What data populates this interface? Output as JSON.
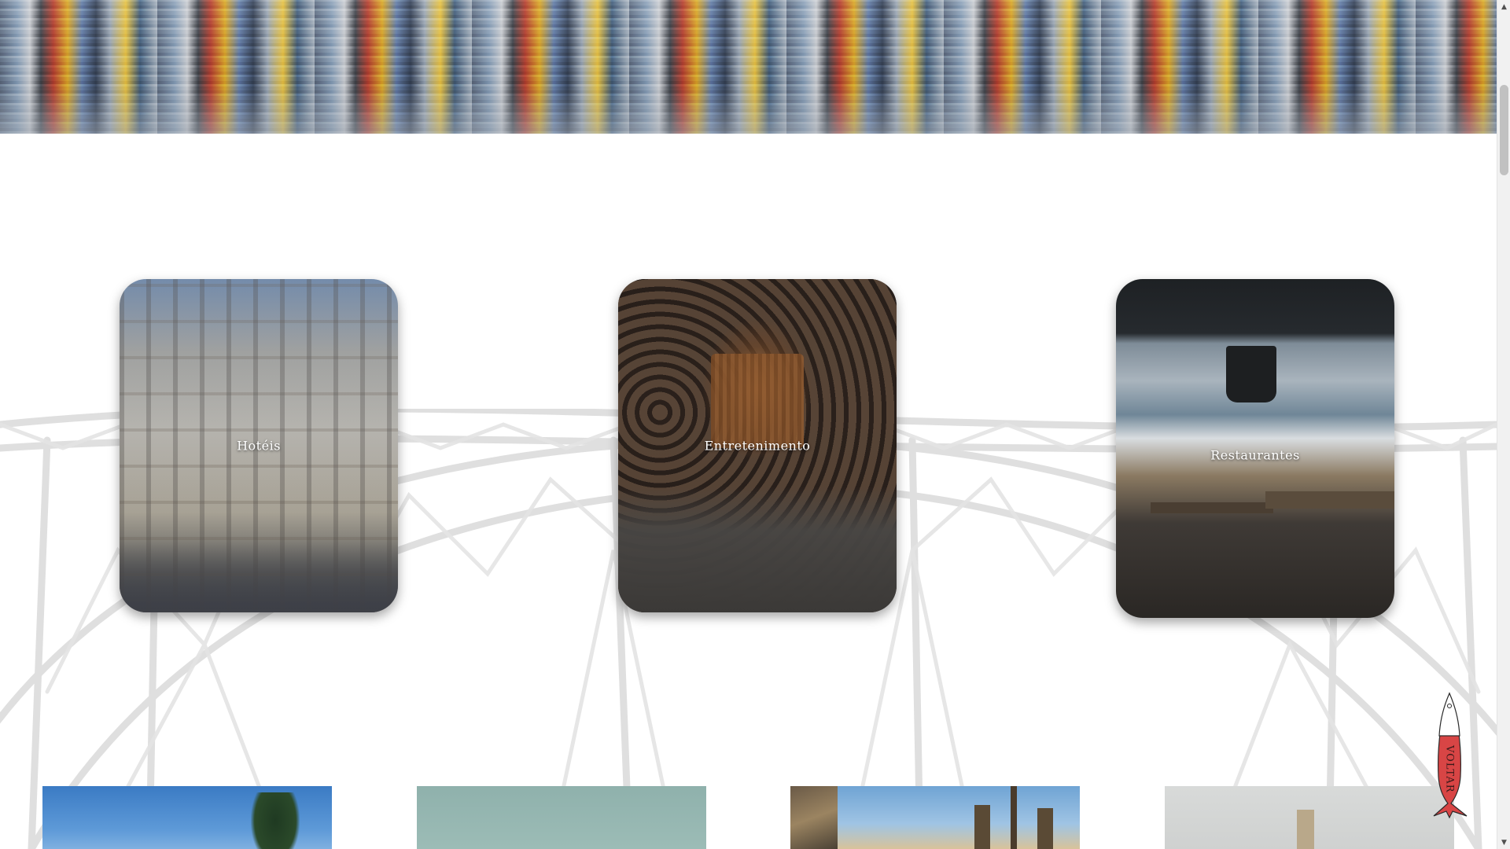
{
  "hero": {
    "image_name": "porto-river-reflection"
  },
  "categories": [
    {
      "label": "Hotéis",
      "image_name": "hotel-facade-photo"
    },
    {
      "label": "Entretenimento",
      "image_name": "wine-cellar-photo"
    },
    {
      "label": "Restaurantes",
      "image_name": "restaurant-sea-view-photo"
    }
  ],
  "thumbnails": [
    {
      "image_name": "tree-sky-photo"
    },
    {
      "image_name": "teal-wall-photo"
    },
    {
      "image_name": "rooftop-statues-photo"
    },
    {
      "image_name": "grey-sky-photo"
    }
  ],
  "back_button": {
    "label": "VOLTAR",
    "icon": "sardine-icon",
    "color": "#d84545"
  },
  "colors": {
    "card_label": "#ffffff",
    "sketch_stroke": "#d9d9d9",
    "scrollbar_track": "#f1f1f1",
    "scrollbar_thumb": "#c1c1c1"
  },
  "scrollbar": {
    "up_icon": "scroll-up-arrow-icon",
    "down_icon": "scroll-down-arrow-icon"
  }
}
